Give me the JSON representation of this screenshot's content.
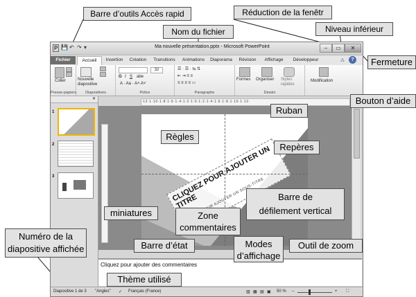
{
  "window": {
    "title": "Ma nouvelle présentation.pptx - Microsoft PowerPoint",
    "min_btn": "–",
    "restore_btn": "▭",
    "close_btn": "✕",
    "quick_access": [
      "P",
      "💾",
      "↶",
      "↷",
      "▾"
    ],
    "help_glyph": "?",
    "collapse_glyph": "△"
  },
  "tabs": [
    "Fichier",
    "Accueil",
    "Insertion",
    "Création",
    "Transitions",
    "Animations",
    "Diaporama",
    "Révision",
    "Affichage",
    "Développeur"
  ],
  "ribbon": {
    "groups": [
      "Presse-papiers",
      "Diapositives",
      "Police",
      "Paragraphe",
      "Dessin",
      ""
    ],
    "coller": "Coller",
    "nouvelle_diapositive": "Nouvelle\ndiapositive",
    "font_size": "32",
    "formes": "Formes",
    "organiser": "Organiser",
    "styles_rapides": "Styles\nrapides",
    "modification": "Modification"
  },
  "rulers": {
    "horizontal": "·12·1·10·1·8·1·6·1·4·1·2·1·0·1·2·1·4·1·6·1·8·1·10·1·12·"
  },
  "slide": {
    "title_placeholder": "CLIQUEZ POUR AJOUTER UN TITRE",
    "subtitle_placeholder": "CLIQUEZ POUR AJOUTER UN SOUS-TITRE"
  },
  "thumbnails": [
    "1",
    "2",
    "3"
  ],
  "notes": {
    "placeholder": "Cliquez pour ajouter des commentaires"
  },
  "statusbar": {
    "slide_of": "Diapositive 1 de 3",
    "theme": "\"Angles\"",
    "language": "Français (France)",
    "zoom": "50 %",
    "zoom_minus": "–",
    "zoom_plus": "+"
  },
  "callouts": {
    "barre_outils": "Barre d’outils Accès rapid",
    "reduction": "Réduction de la fenêtr",
    "nom_fichier": "Nom du fichier",
    "niveau_inferieur": "Niveau inférieur",
    "fermeture": "Fermeture",
    "bouton_aide": "Bouton d’aide",
    "ruban": "Ruban",
    "regles": "Règles",
    "reperes": "Repères",
    "miniatures": "miniatures",
    "barre_defilement": "Barre de\ndéfilement vertical",
    "zone_commentaires": "Zone\ncommentaires",
    "numero_diapositive": "Numéro de la\ndiapositive affichée",
    "barre_etat": "Barre d’état",
    "modes_affichage": "Modes\nd’affichage",
    "outil_zoom": "Outil de zoom",
    "theme_utilise": "Thème utilisé"
  }
}
